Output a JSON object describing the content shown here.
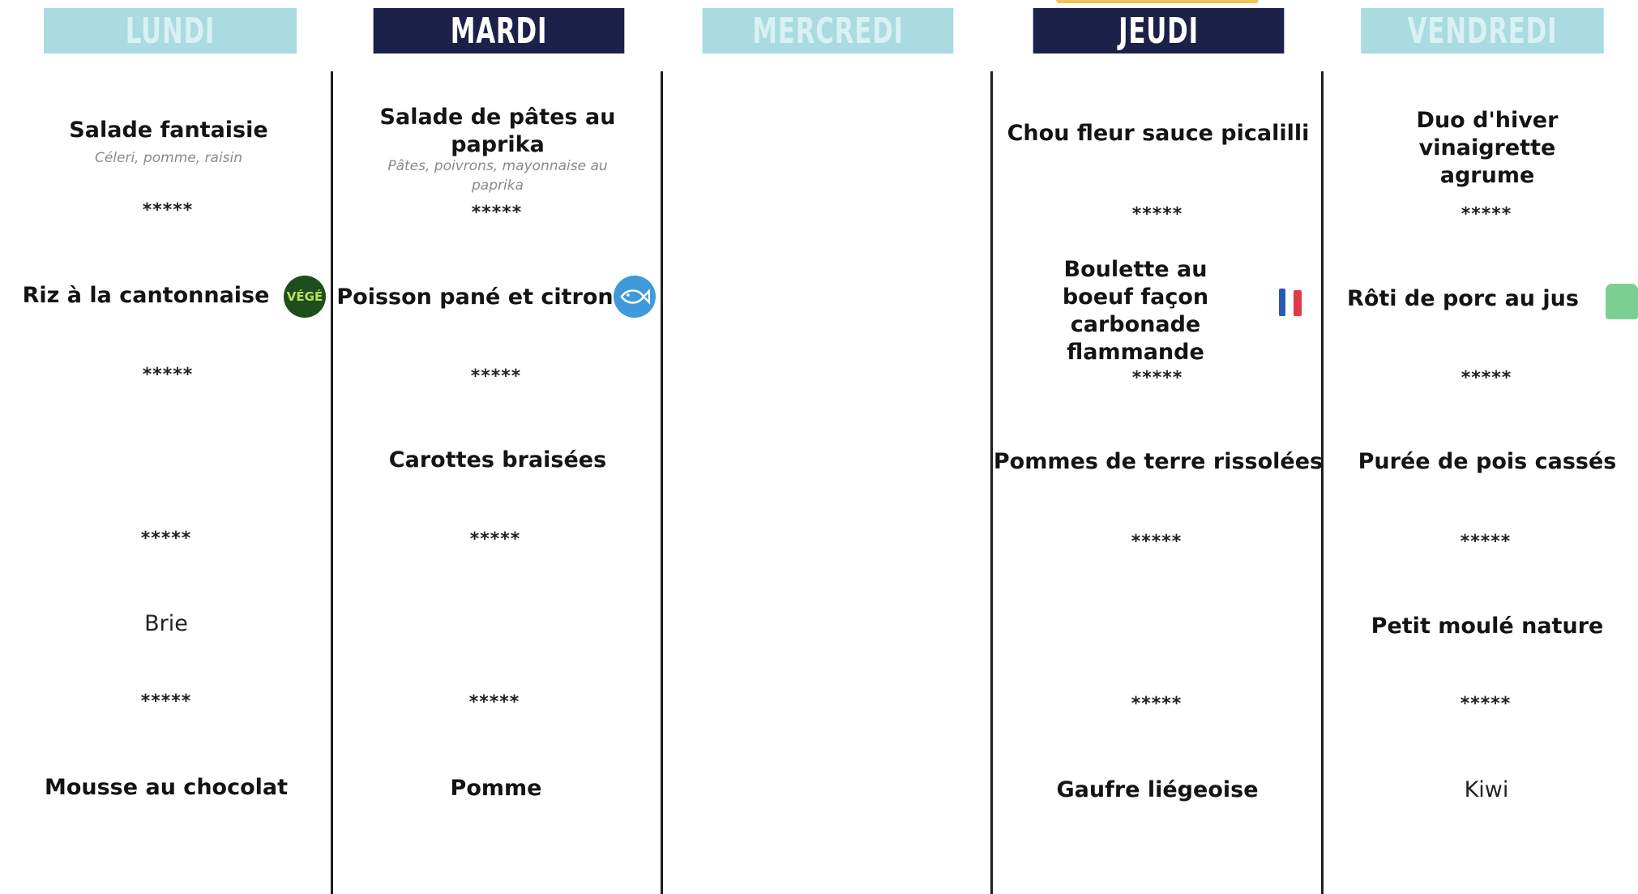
{
  "days": [
    {
      "label": "LUNDI"
    },
    {
      "label": "MARDI"
    },
    {
      "label": "MERCREDI"
    },
    {
      "label": "JEUDI"
    },
    {
      "label": "VENDREDI"
    }
  ],
  "separator": "*****",
  "lundi": {
    "starter": "Salade fantaisie",
    "starter_sub": "Céleri, pomme, raisin",
    "main": "Riz à la cantonnaise",
    "main_badge": "VÉGÉ",
    "cheese": "Brie",
    "dessert": "Mousse au chocolat"
  },
  "mardi": {
    "starter": "Salade de pâtes au paprika",
    "starter_sub": "Pâtes, poivrons, mayonnaise au paprika",
    "main": "Poisson pané et citron",
    "side": "Carottes braisées",
    "dessert": "Pomme"
  },
  "jeudi": {
    "starter": "Chou fleur sauce picalilli",
    "main": "Boulette au boeuf façon carbonade flammande",
    "side": "Pommes de terre rissolées",
    "dessert": "Gaufre liégeoise"
  },
  "vendredi": {
    "starter": "Duo d'hiver vinaigrette agrume",
    "main": "Rôti de porc au jus",
    "side": "Purée de pois cassés",
    "cheese": "Petit moulé nature",
    "dessert": "Kiwi"
  },
  "colors": {
    "header_light": "#a9dbe0",
    "header_dark": "#1b2148",
    "vege_badge": "#1d4e1b",
    "fish_badge": "#3e9ad9"
  },
  "icons": [
    "vege-badge-icon",
    "fish-icon",
    "france-flag-icon",
    "pork-label-icon"
  ]
}
